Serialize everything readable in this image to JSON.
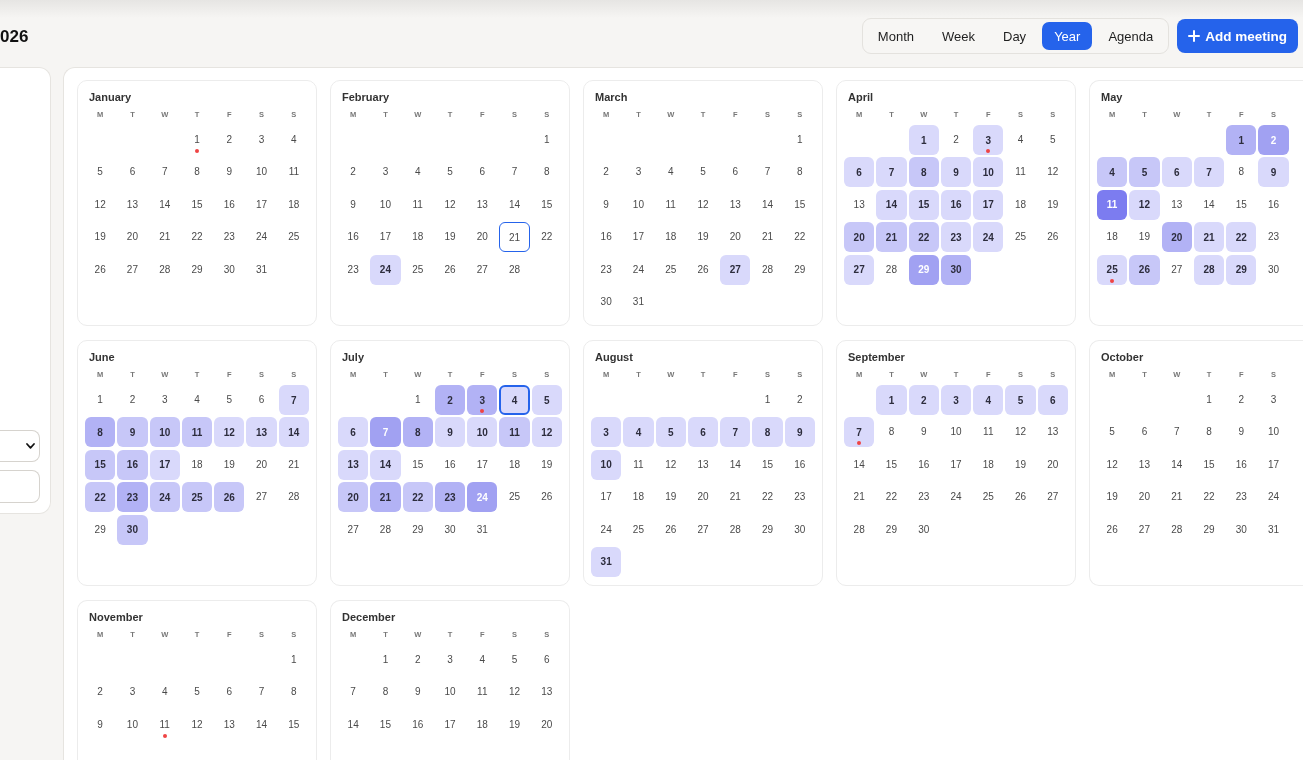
{
  "title": "026",
  "views": [
    {
      "label": "Month",
      "selected": false
    },
    {
      "label": "Week",
      "selected": false
    },
    {
      "label": "Day",
      "selected": false
    },
    {
      "label": "Year",
      "selected": true
    },
    {
      "label": "Agenda",
      "selected": false
    }
  ],
  "add_button": {
    "label": "Add meeting"
  },
  "sidebar": {
    "fields": [
      {
        "kind": "select"
      },
      {
        "kind": "input"
      }
    ]
  },
  "months": [
    {
      "name": "January",
      "weekdays": [
        "M",
        "T",
        "W",
        "T",
        "F",
        "S",
        "S"
      ],
      "weeks": [
        [
          {
            "kind": "blank"
          },
          {
            "kind": "blank"
          },
          {
            "kind": "blank"
          },
          {
            "kind": "event",
            "day": "1"
          },
          {
            "kind": "day",
            "day": "2"
          },
          {
            "kind": "day",
            "day": "3"
          },
          {
            "kind": "day",
            "day": "4"
          }
        ],
        [
          {
            "kind": "day",
            "day": "5"
          },
          {
            "kind": "day",
            "day": "6"
          },
          {
            "kind": "day",
            "day": "7"
          },
          {
            "kind": "day",
            "day": "8"
          },
          {
            "kind": "day",
            "day": "9"
          },
          {
            "kind": "day",
            "day": "10"
          },
          {
            "kind": "day",
            "day": "11"
          }
        ],
        [
          {
            "kind": "day",
            "day": "12"
          },
          {
            "kind": "day",
            "day": "13"
          },
          {
            "kind": "day",
            "day": "14"
          },
          {
            "kind": "day",
            "day": "15"
          },
          {
            "kind": "day",
            "day": "16"
          },
          {
            "kind": "day",
            "day": "17"
          },
          {
            "kind": "day",
            "day": "18"
          }
        ],
        [
          {
            "kind": "day",
            "day": "19"
          },
          {
            "kind": "day",
            "day": "20"
          },
          {
            "kind": "day",
            "day": "21"
          },
          {
            "kind": "day",
            "day": "22"
          },
          {
            "kind": "day",
            "day": "23"
          },
          {
            "kind": "day",
            "day": "24"
          },
          {
            "kind": "day",
            "day": "25"
          }
        ],
        [
          {
            "kind": "day",
            "day": "26"
          },
          {
            "kind": "day",
            "day": "27"
          },
          {
            "kind": "day",
            "day": "28"
          },
          {
            "kind": "day",
            "day": "29"
          },
          {
            "kind": "day",
            "day": "30"
          },
          {
            "kind": "day",
            "day": "31"
          }
        ]
      ]
    },
    {
      "name": "February",
      "weekdays": [
        "M",
        "T",
        "W",
        "T",
        "F",
        "S",
        "S"
      ],
      "weeks": [
        [
          {
            "kind": "blank"
          },
          {
            "kind": "blank"
          },
          {
            "kind": "blank"
          },
          {
            "kind": "blank"
          },
          {
            "kind": "blank"
          },
          {
            "kind": "blank"
          },
          {
            "kind": "day",
            "day": "1"
          }
        ],
        [
          {
            "kind": "day",
            "day": "2"
          },
          {
            "kind": "day",
            "day": "3"
          },
          {
            "kind": "day",
            "day": "4"
          },
          {
            "kind": "day",
            "day": "5"
          },
          {
            "kind": "day",
            "day": "6"
          },
          {
            "kind": "day",
            "day": "7"
          },
          {
            "kind": "day",
            "day": "8"
          }
        ],
        [
          {
            "kind": "day",
            "day": "9"
          },
          {
            "kind": "day",
            "day": "10"
          },
          {
            "kind": "day",
            "day": "11"
          },
          {
            "kind": "day",
            "day": "12"
          },
          {
            "kind": "day",
            "day": "13"
          },
          {
            "kind": "day",
            "day": "14"
          },
          {
            "kind": "day",
            "day": "15"
          }
        ],
        [
          {
            "kind": "day",
            "day": "16"
          },
          {
            "kind": "day",
            "day": "17"
          },
          {
            "kind": "day",
            "day": "18"
          },
          {
            "kind": "day",
            "day": "19"
          },
          {
            "kind": "day",
            "day": "20"
          },
          {
            "kind": "today",
            "day": "21"
          },
          {
            "kind": "day",
            "day": "22"
          }
        ],
        [
          {
            "kind": "day",
            "day": "23"
          },
          {
            "kind": "day",
            "day": "24",
            "color": "#d9d9fb"
          },
          {
            "kind": "day",
            "day": "25"
          },
          {
            "kind": "day",
            "day": "26"
          },
          {
            "kind": "day",
            "day": "27"
          },
          {
            "kind": "day",
            "day": "28"
          }
        ]
      ]
    },
    {
      "name": "March",
      "weekdays": [
        "M",
        "T",
        "W",
        "T",
        "F",
        "S",
        "S"
      ],
      "weeks": [
        [
          {
            "kind": "blank"
          },
          {
            "kind": "blank"
          },
          {
            "kind": "blank"
          },
          {
            "kind": "blank"
          },
          {
            "kind": "blank"
          },
          {
            "kind": "blank"
          },
          {
            "kind": "day",
            "day": "1"
          }
        ],
        [
          {
            "kind": "day",
            "day": "2"
          },
          {
            "kind": "day",
            "day": "3"
          },
          {
            "kind": "day",
            "day": "4"
          },
          {
            "kind": "day",
            "day": "5"
          },
          {
            "kind": "day",
            "day": "6"
          },
          {
            "kind": "day",
            "day": "7"
          },
          {
            "kind": "day",
            "day": "8"
          }
        ],
        [
          {
            "kind": "day",
            "day": "9"
          },
          {
            "kind": "day",
            "day": "10"
          },
          {
            "kind": "day",
            "day": "11"
          },
          {
            "kind": "day",
            "day": "12"
          },
          {
            "kind": "day",
            "day": "13"
          },
          {
            "kind": "day",
            "day": "14"
          },
          {
            "kind": "day",
            "day": "15"
          }
        ],
        [
          {
            "kind": "day",
            "day": "16"
          },
          {
            "kind": "day",
            "day": "17"
          },
          {
            "kind": "day",
            "day": "18"
          },
          {
            "kind": "day",
            "day": "19"
          },
          {
            "kind": "day",
            "day": "20"
          },
          {
            "kind": "day",
            "day": "21"
          },
          {
            "kind": "day",
            "day": "22"
          }
        ],
        [
          {
            "kind": "day",
            "day": "23"
          },
          {
            "kind": "day",
            "day": "24"
          },
          {
            "kind": "day",
            "day": "25"
          },
          {
            "kind": "day",
            "day": "26"
          },
          {
            "kind": "day",
            "day": "27",
            "color": "#d9d9fb"
          },
          {
            "kind": "day",
            "day": "28"
          },
          {
            "kind": "day",
            "day": "29"
          }
        ],
        [
          {
            "kind": "day",
            "day": "30"
          },
          {
            "kind": "day",
            "day": "31"
          }
        ]
      ]
    },
    {
      "name": "April",
      "weekdays": [
        "M",
        "T",
        "W",
        "T",
        "F",
        "S",
        "S"
      ],
      "weeks": [
        [
          {
            "kind": "blank"
          },
          {
            "kind": "blank"
          },
          {
            "kind": "day",
            "day": "1",
            "color": "#d9d9fb"
          },
          {
            "kind": "day",
            "day": "2"
          },
          {
            "kind": "event",
            "day": "3",
            "color": "#d9d9fb"
          },
          {
            "kind": "day",
            "day": "4"
          },
          {
            "kind": "day",
            "day": "5"
          }
        ],
        [
          {
            "kind": "day",
            "day": "6",
            "color": "#d9d9fb"
          },
          {
            "kind": "day",
            "day": "7",
            "color": "#d9d9fb"
          },
          {
            "kind": "day",
            "day": "8",
            "color": "#c7c7f8"
          },
          {
            "kind": "day",
            "day": "9",
            "color": "#d9d9fb"
          },
          {
            "kind": "day",
            "day": "10",
            "color": "#d9d9fb"
          },
          {
            "kind": "day",
            "day": "11"
          },
          {
            "kind": "day",
            "day": "12"
          }
        ],
        [
          {
            "kind": "day",
            "day": "13"
          },
          {
            "kind": "day",
            "day": "14",
            "color": "#d9d9fb"
          },
          {
            "kind": "day",
            "day": "15",
            "color": "#d9d9fb"
          },
          {
            "kind": "day",
            "day": "16",
            "color": "#d9d9fb"
          },
          {
            "kind": "day",
            "day": "17",
            "color": "#d9d9fb"
          },
          {
            "kind": "day",
            "day": "18"
          },
          {
            "kind": "day",
            "day": "19"
          }
        ],
        [
          {
            "kind": "day",
            "day": "20",
            "color": "#c7c7f8"
          },
          {
            "kind": "day",
            "day": "21",
            "color": "#c7c7f8"
          },
          {
            "kind": "day",
            "day": "22",
            "color": "#c7c7f8"
          },
          {
            "kind": "day",
            "day": "23",
            "color": "#d9d9fb"
          },
          {
            "kind": "day",
            "day": "24",
            "color": "#d9d9fb"
          },
          {
            "kind": "day",
            "day": "25"
          },
          {
            "kind": "day",
            "day": "26"
          }
        ],
        [
          {
            "kind": "day",
            "day": "27",
            "color": "#d9d9fb"
          },
          {
            "kind": "day",
            "day": "28"
          },
          {
            "kind": "day",
            "day": "29",
            "color": "#a1a1f2"
          },
          {
            "kind": "day",
            "day": "30",
            "color": "#b2b2f5"
          }
        ]
      ]
    },
    {
      "name": "May",
      "weekdays": [
        "M",
        "T",
        "W",
        "T",
        "F",
        "S"
      ],
      "weeks": [
        [
          {
            "kind": "blank"
          },
          {
            "kind": "blank"
          },
          {
            "kind": "blank"
          },
          {
            "kind": "blank"
          },
          {
            "kind": "day",
            "day": "1",
            "color": "#b2b2f5"
          },
          {
            "kind": "day",
            "day": "2",
            "color": "#a1a1f2"
          }
        ],
        [
          {
            "kind": "day",
            "day": "4",
            "color": "#c7c7f8"
          },
          {
            "kind": "day",
            "day": "5",
            "color": "#c7c7f8"
          },
          {
            "kind": "day",
            "day": "6",
            "color": "#d9d9fb"
          },
          {
            "kind": "day",
            "day": "7",
            "color": "#d9d9fb"
          },
          {
            "kind": "day",
            "day": "8"
          },
          {
            "kind": "day",
            "day": "9",
            "color": "#d9d9fb"
          }
        ],
        [
          {
            "kind": "day",
            "day": "11",
            "color": "#7c7cf0"
          },
          {
            "kind": "day",
            "day": "12",
            "color": "#d9d9fb"
          },
          {
            "kind": "day",
            "day": "13"
          },
          {
            "kind": "day",
            "day": "14"
          },
          {
            "kind": "day",
            "day": "15"
          },
          {
            "kind": "day",
            "day": "16"
          }
        ],
        [
          {
            "kind": "day",
            "day": "18"
          },
          {
            "kind": "day",
            "day": "19"
          },
          {
            "kind": "day",
            "day": "20",
            "color": "#b2b2f5"
          },
          {
            "kind": "day",
            "day": "21",
            "color": "#d9d9fb"
          },
          {
            "kind": "day",
            "day": "22",
            "color": "#d9d9fb"
          },
          {
            "kind": "day",
            "day": "23"
          }
        ],
        [
          {
            "kind": "event",
            "day": "25",
            "color": "#d9d9fb"
          },
          {
            "kind": "day",
            "day": "26",
            "color": "#c7c7f8"
          },
          {
            "kind": "day",
            "day": "27"
          },
          {
            "kind": "day",
            "day": "28",
            "color": "#d9d9fb"
          },
          {
            "kind": "day",
            "day": "29",
            "color": "#d9d9fb"
          },
          {
            "kind": "day",
            "day": "30"
          }
        ]
      ]
    },
    {
      "name": "June",
      "weekdays": [
        "M",
        "T",
        "W",
        "T",
        "F",
        "S",
        "S"
      ],
      "weeks": [
        [
          {
            "kind": "day",
            "day": "1"
          },
          {
            "kind": "day",
            "day": "2"
          },
          {
            "kind": "day",
            "day": "3"
          },
          {
            "kind": "day",
            "day": "4"
          },
          {
            "kind": "day",
            "day": "5"
          },
          {
            "kind": "day",
            "day": "6"
          },
          {
            "kind": "day",
            "day": "7",
            "color": "#d9d9fb"
          }
        ],
        [
          {
            "kind": "day",
            "day": "8",
            "color": "#b2b2f5"
          },
          {
            "kind": "day",
            "day": "9",
            "color": "#c7c7f8"
          },
          {
            "kind": "day",
            "day": "10",
            "color": "#c7c7f8"
          },
          {
            "kind": "day",
            "day": "11",
            "color": "#c7c7f8"
          },
          {
            "kind": "day",
            "day": "12",
            "color": "#d9d9fb"
          },
          {
            "kind": "day",
            "day": "13",
            "color": "#d9d9fb"
          },
          {
            "kind": "day",
            "day": "14",
            "color": "#d9d9fb"
          }
        ],
        [
          {
            "kind": "day",
            "day": "15",
            "color": "#c7c7f8"
          },
          {
            "kind": "day",
            "day": "16",
            "color": "#c7c7f8"
          },
          {
            "kind": "day",
            "day": "17",
            "color": "#d9d9fb"
          },
          {
            "kind": "day",
            "day": "18"
          },
          {
            "kind": "day",
            "day": "19"
          },
          {
            "kind": "day",
            "day": "20"
          },
          {
            "kind": "day",
            "day": "21"
          }
        ],
        [
          {
            "kind": "day",
            "day": "22",
            "color": "#c7c7f8"
          },
          {
            "kind": "day",
            "day": "23",
            "color": "#b2b2f5"
          },
          {
            "kind": "day",
            "day": "24",
            "color": "#c7c7f8"
          },
          {
            "kind": "day",
            "day": "25",
            "color": "#c7c7f8"
          },
          {
            "kind": "day",
            "day": "26",
            "color": "#c7c7f8"
          },
          {
            "kind": "day",
            "day": "27"
          },
          {
            "kind": "day",
            "day": "28"
          }
        ],
        [
          {
            "kind": "day",
            "day": "29"
          },
          {
            "kind": "day",
            "day": "30",
            "color": "#c7c7f8"
          }
        ]
      ]
    },
    {
      "name": "July",
      "weekdays": [
        "M",
        "T",
        "W",
        "T",
        "F",
        "S",
        "S"
      ],
      "weeks": [
        [
          {
            "kind": "blank"
          },
          {
            "kind": "blank"
          },
          {
            "kind": "day",
            "day": "1"
          },
          {
            "kind": "day",
            "day": "2",
            "color": "#b2b2f5"
          },
          {
            "kind": "event",
            "day": "3",
            "color": "#b2b2f5"
          },
          {
            "kind": "selected",
            "day": "4",
            "color": "#d9d9fb"
          },
          {
            "kind": "day",
            "day": "5",
            "color": "#d9d9fb"
          }
        ],
        [
          {
            "kind": "day",
            "day": "6",
            "color": "#d9d9fb"
          },
          {
            "kind": "day",
            "day": "7",
            "color": "#a1a1f2"
          },
          {
            "kind": "day",
            "day": "8",
            "color": "#b2b2f5"
          },
          {
            "kind": "day",
            "day": "9",
            "color": "#d9d9fb"
          },
          {
            "kind": "day",
            "day": "10",
            "color": "#d9d9fb"
          },
          {
            "kind": "day",
            "day": "11",
            "color": "#c7c7f8"
          },
          {
            "kind": "day",
            "day": "12",
            "color": "#d9d9fb"
          }
        ],
        [
          {
            "kind": "day",
            "day": "13",
            "color": "#d9d9fb"
          },
          {
            "kind": "day",
            "day": "14",
            "color": "#d9d9fb"
          },
          {
            "kind": "day",
            "day": "15"
          },
          {
            "kind": "day",
            "day": "16"
          },
          {
            "kind": "day",
            "day": "17"
          },
          {
            "kind": "day",
            "day": "18"
          },
          {
            "kind": "day",
            "day": "19"
          }
        ],
        [
          {
            "kind": "day",
            "day": "20",
            "color": "#c7c7f8"
          },
          {
            "kind": "day",
            "day": "21",
            "color": "#b2b2f5"
          },
          {
            "kind": "day",
            "day": "22",
            "color": "#c7c7f8"
          },
          {
            "kind": "day",
            "day": "23",
            "color": "#b2b2f5"
          },
          {
            "kind": "day",
            "day": "24",
            "color": "#a1a1f2"
          },
          {
            "kind": "day",
            "day": "25"
          },
          {
            "kind": "day",
            "day": "26"
          }
        ],
        [
          {
            "kind": "day",
            "day": "27"
          },
          {
            "kind": "day",
            "day": "28"
          },
          {
            "kind": "day",
            "day": "29"
          },
          {
            "kind": "day",
            "day": "30"
          },
          {
            "kind": "day",
            "day": "31"
          }
        ]
      ]
    },
    {
      "name": "August",
      "weekdays": [
        "M",
        "T",
        "W",
        "T",
        "F",
        "S",
        "S"
      ],
      "weeks": [
        [
          {
            "kind": "blank"
          },
          {
            "kind": "blank"
          },
          {
            "kind": "blank"
          },
          {
            "kind": "blank"
          },
          {
            "kind": "blank"
          },
          {
            "kind": "day",
            "day": "1"
          },
          {
            "kind": "day",
            "day": "2"
          }
        ],
        [
          {
            "kind": "day",
            "day": "3",
            "color": "#d9d9fb"
          },
          {
            "kind": "day",
            "day": "4",
            "color": "#d9d9fb"
          },
          {
            "kind": "day",
            "day": "5",
            "color": "#d9d9fb"
          },
          {
            "kind": "day",
            "day": "6",
            "color": "#d9d9fb"
          },
          {
            "kind": "day",
            "day": "7",
            "color": "#d9d9fb"
          },
          {
            "kind": "day",
            "day": "8",
            "color": "#d9d9fb"
          },
          {
            "kind": "day",
            "day": "9",
            "color": "#d9d9fb"
          }
        ],
        [
          {
            "kind": "day",
            "day": "10",
            "color": "#d9d9fb"
          },
          {
            "kind": "day",
            "day": "11"
          },
          {
            "kind": "day",
            "day": "12"
          },
          {
            "kind": "day",
            "day": "13"
          },
          {
            "kind": "day",
            "day": "14"
          },
          {
            "kind": "day",
            "day": "15"
          },
          {
            "kind": "day",
            "day": "16"
          }
        ],
        [
          {
            "kind": "day",
            "day": "17"
          },
          {
            "kind": "day",
            "day": "18"
          },
          {
            "kind": "day",
            "day": "19"
          },
          {
            "kind": "day",
            "day": "20"
          },
          {
            "kind": "day",
            "day": "21"
          },
          {
            "kind": "day",
            "day": "22"
          },
          {
            "kind": "day",
            "day": "23"
          }
        ],
        [
          {
            "kind": "day",
            "day": "24"
          },
          {
            "kind": "day",
            "day": "25"
          },
          {
            "kind": "day",
            "day": "26"
          },
          {
            "kind": "day",
            "day": "27"
          },
          {
            "kind": "day",
            "day": "28"
          },
          {
            "kind": "day",
            "day": "29"
          },
          {
            "kind": "day",
            "day": "30"
          }
        ],
        [
          {
            "kind": "day",
            "day": "31",
            "color": "#d9d9fb"
          }
        ]
      ]
    },
    {
      "name": "September",
      "weekdays": [
        "M",
        "T",
        "W",
        "T",
        "F",
        "S",
        "S"
      ],
      "weeks": [
        [
          {
            "kind": "blank"
          },
          {
            "kind": "day",
            "day": "1",
            "color": "#d9d9fb"
          },
          {
            "kind": "day",
            "day": "2",
            "color": "#d9d9fb"
          },
          {
            "kind": "day",
            "day": "3",
            "color": "#d9d9fb"
          },
          {
            "kind": "day",
            "day": "4",
            "color": "#d9d9fb"
          },
          {
            "kind": "day",
            "day": "5",
            "color": "#d9d9fb"
          },
          {
            "kind": "day",
            "day": "6",
            "color": "#d9d9fb"
          }
        ],
        [
          {
            "kind": "event",
            "day": "7",
            "color": "#d9d9fb"
          },
          {
            "kind": "day",
            "day": "8"
          },
          {
            "kind": "day",
            "day": "9"
          },
          {
            "kind": "day",
            "day": "10"
          },
          {
            "kind": "day",
            "day": "11"
          },
          {
            "kind": "day",
            "day": "12"
          },
          {
            "kind": "day",
            "day": "13"
          }
        ],
        [
          {
            "kind": "day",
            "day": "14"
          },
          {
            "kind": "day",
            "day": "15"
          },
          {
            "kind": "day",
            "day": "16"
          },
          {
            "kind": "day",
            "day": "17"
          },
          {
            "kind": "day",
            "day": "18"
          },
          {
            "kind": "day",
            "day": "19"
          },
          {
            "kind": "day",
            "day": "20"
          }
        ],
        [
          {
            "kind": "day",
            "day": "21"
          },
          {
            "kind": "day",
            "day": "22"
          },
          {
            "kind": "day",
            "day": "23"
          },
          {
            "kind": "day",
            "day": "24"
          },
          {
            "kind": "day",
            "day": "25"
          },
          {
            "kind": "day",
            "day": "26"
          },
          {
            "kind": "day",
            "day": "27"
          }
        ],
        [
          {
            "kind": "day",
            "day": "28"
          },
          {
            "kind": "day",
            "day": "29"
          },
          {
            "kind": "day",
            "day": "30"
          }
        ]
      ]
    },
    {
      "name": "October",
      "weekdays": [
        "M",
        "T",
        "W",
        "T",
        "F",
        "S"
      ],
      "weeks": [
        [
          {
            "kind": "blank"
          },
          {
            "kind": "blank"
          },
          {
            "kind": "blank"
          },
          {
            "kind": "day",
            "day": "1"
          },
          {
            "kind": "day",
            "day": "2"
          },
          {
            "kind": "day",
            "day": "3"
          }
        ],
        [
          {
            "kind": "day",
            "day": "5"
          },
          {
            "kind": "day",
            "day": "6"
          },
          {
            "kind": "day",
            "day": "7"
          },
          {
            "kind": "day",
            "day": "8"
          },
          {
            "kind": "day",
            "day": "9"
          },
          {
            "kind": "day",
            "day": "10"
          }
        ],
        [
          {
            "kind": "day",
            "day": "12"
          },
          {
            "kind": "day",
            "day": "13"
          },
          {
            "kind": "day",
            "day": "14"
          },
          {
            "kind": "day",
            "day": "15"
          },
          {
            "kind": "day",
            "day": "16"
          },
          {
            "kind": "day",
            "day": "17"
          }
        ],
        [
          {
            "kind": "day",
            "day": "19"
          },
          {
            "kind": "day",
            "day": "20"
          },
          {
            "kind": "day",
            "day": "21"
          },
          {
            "kind": "day",
            "day": "22"
          },
          {
            "kind": "day",
            "day": "23"
          },
          {
            "kind": "day",
            "day": "24"
          }
        ],
        [
          {
            "kind": "day",
            "day": "26"
          },
          {
            "kind": "day",
            "day": "27"
          },
          {
            "kind": "day",
            "day": "28"
          },
          {
            "kind": "day",
            "day": "29"
          },
          {
            "kind": "day",
            "day": "30"
          },
          {
            "kind": "day",
            "day": "31"
          }
        ]
      ]
    },
    {
      "name": "November",
      "weekdays": [
        "M",
        "T",
        "W",
        "T",
        "F",
        "S",
        "S"
      ],
      "weeks": [
        [
          {
            "kind": "blank"
          },
          {
            "kind": "blank"
          },
          {
            "kind": "blank"
          },
          {
            "kind": "blank"
          },
          {
            "kind": "blank"
          },
          {
            "kind": "blank"
          },
          {
            "kind": "day",
            "day": "1"
          }
        ],
        [
          {
            "kind": "day",
            "day": "2"
          },
          {
            "kind": "day",
            "day": "3"
          },
          {
            "kind": "day",
            "day": "4"
          },
          {
            "kind": "day",
            "day": "5"
          },
          {
            "kind": "day",
            "day": "6"
          },
          {
            "kind": "day",
            "day": "7"
          },
          {
            "kind": "day",
            "day": "8"
          }
        ],
        [
          {
            "kind": "day",
            "day": "9"
          },
          {
            "kind": "day",
            "day": "10"
          },
          {
            "kind": "event",
            "day": "11"
          },
          {
            "kind": "day",
            "day": "12"
          },
          {
            "kind": "day",
            "day": "13"
          },
          {
            "kind": "day",
            "day": "14"
          },
          {
            "kind": "day",
            "day": "15"
          }
        ]
      ]
    },
    {
      "name": "December",
      "weekdays": [
        "M",
        "T",
        "W",
        "T",
        "F",
        "S",
        "S"
      ],
      "weeks": [
        [
          {
            "kind": "blank"
          },
          {
            "kind": "day",
            "day": "1"
          },
          {
            "kind": "day",
            "day": "2"
          },
          {
            "kind": "day",
            "day": "3"
          },
          {
            "kind": "day",
            "day": "4"
          },
          {
            "kind": "day",
            "day": "5"
          },
          {
            "kind": "day",
            "day": "6"
          }
        ],
        [
          {
            "kind": "day",
            "day": "7"
          },
          {
            "kind": "day",
            "day": "8"
          },
          {
            "kind": "day",
            "day": "9"
          },
          {
            "kind": "day",
            "day": "10"
          },
          {
            "kind": "day",
            "day": "11"
          },
          {
            "kind": "day",
            "day": "12"
          },
          {
            "kind": "day",
            "day": "13"
          }
        ],
        [
          {
            "kind": "day",
            "day": "14"
          },
          {
            "kind": "day",
            "day": "15"
          },
          {
            "kind": "day",
            "day": "16"
          },
          {
            "kind": "day",
            "day": "17"
          },
          {
            "kind": "day",
            "day": "18"
          },
          {
            "kind": "day",
            "day": "19"
          },
          {
            "kind": "day",
            "day": "20"
          }
        ]
      ]
    }
  ]
}
